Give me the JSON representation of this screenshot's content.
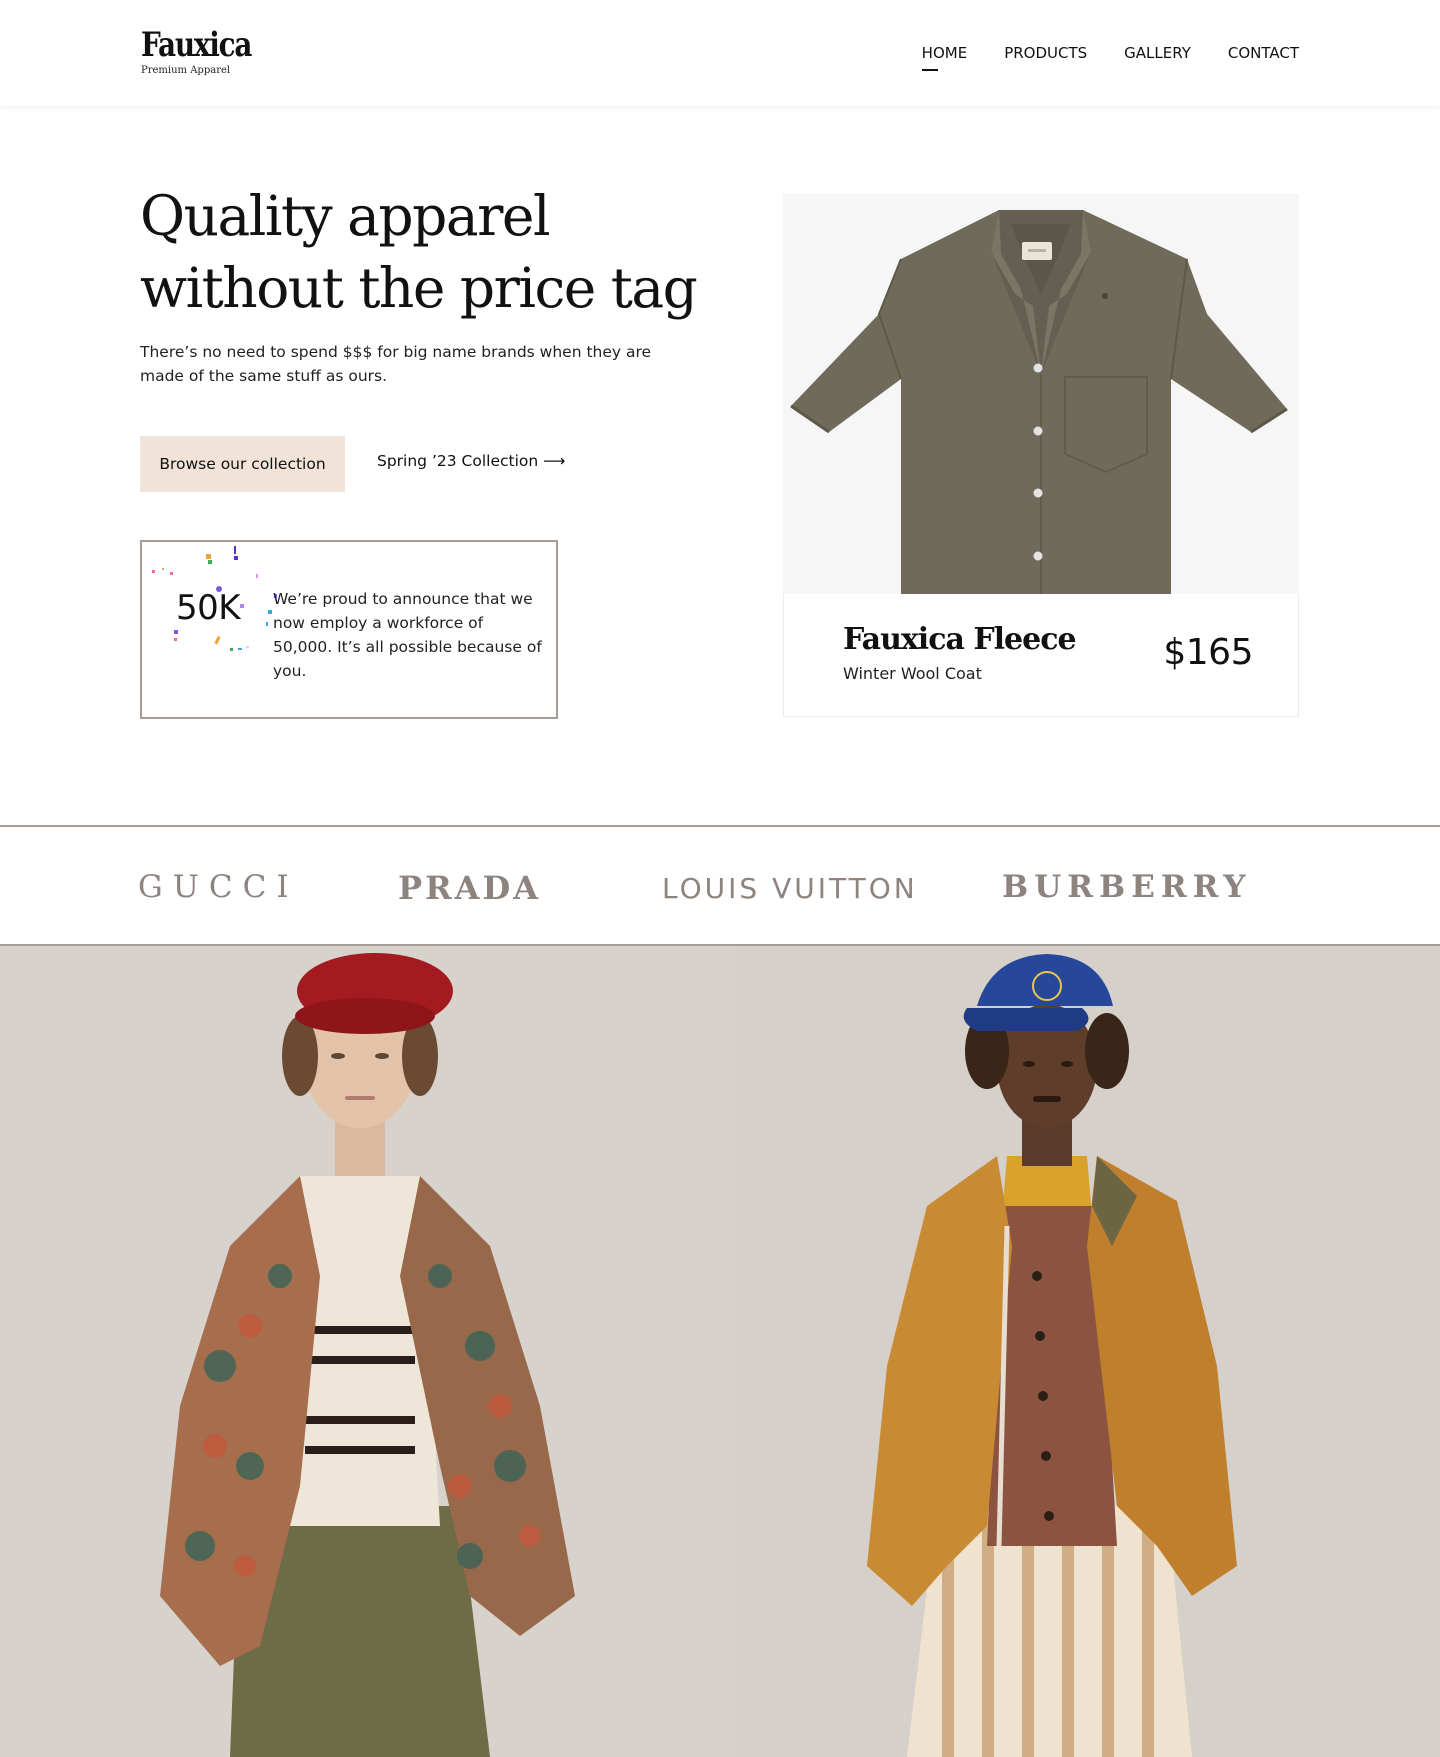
{
  "brand": {
    "name": "Fauxica",
    "tagline": "Premium Apparel"
  },
  "nav": {
    "items": [
      {
        "label": "HOME",
        "active": true
      },
      {
        "label": "PRODUCTS",
        "active": false
      },
      {
        "label": "GALLERY",
        "active": false
      },
      {
        "label": "CONTACT",
        "active": false
      }
    ]
  },
  "hero": {
    "title": "Quality apparel without the price tag",
    "subtitle": "There’s no need to spend $$$ for big name brands when they are made of the same stuff as ours.",
    "primary_cta": "Browse our collection",
    "secondary_cta": "Spring ’23 Collection",
    "secondary_cta_icon": "arrow-right-icon"
  },
  "stat": {
    "number": "50K",
    "text": "We’re proud to announce that we now employ a workforce of 50,000. It’s all possible because of you."
  },
  "product": {
    "name": "Fauxica Fleece",
    "description": "Winter Wool Coat",
    "price": "$165"
  },
  "brands": [
    "GUCCI",
    "PRADA",
    "LOUIS VUITTON",
    "BURBERRY"
  ],
  "colors": {
    "cta_background": "#f1e3d7",
    "border": "#a59d97",
    "brand_logo_gray": "#8d8480",
    "shirt": "#6f6a5a"
  }
}
